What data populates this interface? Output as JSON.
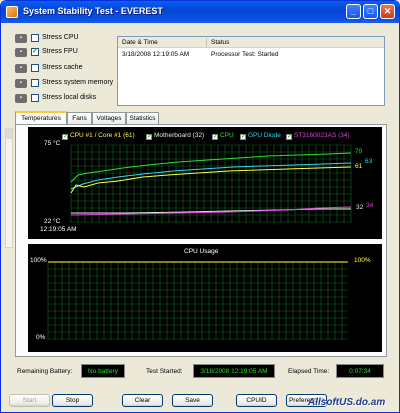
{
  "window": {
    "title": "System Stability Test - EVEREST"
  },
  "stress_options": [
    {
      "label": "Stress CPU",
      "checked": false,
      "icon": "cpu-icon"
    },
    {
      "label": "Stress FPU",
      "checked": true,
      "icon": "fpu-icon"
    },
    {
      "label": "Stress cache",
      "checked": false,
      "icon": "cache-icon"
    },
    {
      "label": "Stress system memory",
      "checked": false,
      "icon": "memory-icon"
    },
    {
      "label": "Stress local disks",
      "checked": false,
      "icon": "disk-icon"
    }
  ],
  "log": {
    "columns": [
      "Date & Time",
      "Status"
    ],
    "rows": [
      {
        "datetime": "3/18/2008 12:19:05 AM",
        "status": "Processor Test: Started"
      }
    ]
  },
  "tabs": [
    "Temperatures",
    "Fans",
    "Voltages",
    "Statistics"
  ],
  "temperature_graph": {
    "legend": [
      {
        "label": "CPU #1 / Core #1 (61)",
        "color": "#ffff40"
      },
      {
        "label": "Motherboard (32)",
        "color": "#e8e8e8"
      },
      {
        "label": "CPU",
        "color": "#30e030"
      },
      {
        "label": "GPU Diode",
        "color": "#30d8f0"
      },
      {
        "label": "ST3160023AS (34)",
        "color": "#e040e0"
      }
    ],
    "y_top_label": "75 °C",
    "y_bottom_label": "22 °C",
    "x_start_label": "12:19:05 AM",
    "end_values": {
      "cpu": "70",
      "gpu": "63",
      "core": "61",
      "mb": "32",
      "hdd": "34"
    }
  },
  "cpu_graph": {
    "title": "CPU Usage",
    "y_top_left": "100%",
    "y_bottom_left": "0%",
    "y_top_right": "100%"
  },
  "status_bar": {
    "battery_label": "Remaining Battery:",
    "battery_value": "No battery",
    "started_label": "Test Started:",
    "started_value": "3/18/2008 12:19:05 AM",
    "elapsed_label": "Elapsed Time:",
    "elapsed_value": "0:07:34"
  },
  "buttons": {
    "start": "Start",
    "stop": "Stop",
    "clear": "Clear",
    "save": "Save",
    "cpuid": "CPUID",
    "preferences": "Preferences"
  },
  "watermark": "AllsoftUS.do.am",
  "colors": {
    "titlebar": "#0a4fe0",
    "graph_grid": "#0d7a2a",
    "accent_green": "#22e022"
  }
}
